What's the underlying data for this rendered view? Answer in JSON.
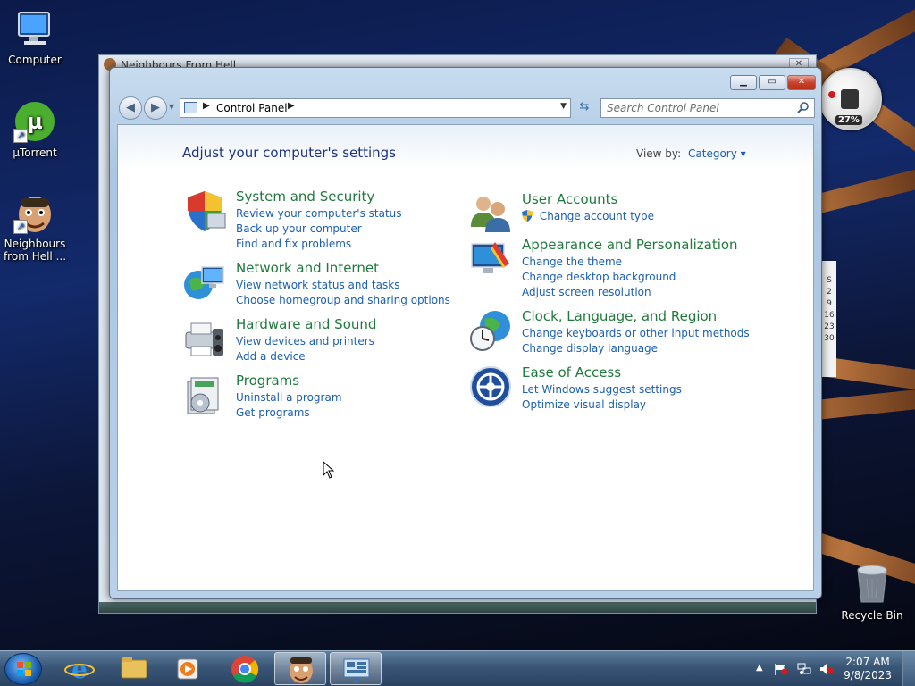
{
  "desktop": {
    "icons": [
      {
        "label": "Computer"
      },
      {
        "label": "µTorrent"
      },
      {
        "label": "Neighbours from Hell ..."
      },
      {
        "label": "Recycle Bin"
      }
    ]
  },
  "background_window": {
    "title": "Neighbours From Hell",
    "close_label": "✕"
  },
  "gadget": {
    "percent": "27%",
    "calendar_days": [
      "S",
      "2",
      "9",
      "16",
      "23",
      "30"
    ]
  },
  "window": {
    "minimize_label": "▁",
    "maximize_label": "▭",
    "close_label": "✕",
    "back_label": "◀",
    "forward_label": "▶",
    "address_path": "Control Panel",
    "search_placeholder": "Search Control Panel"
  },
  "main": {
    "title": "Adjust your computer's settings",
    "view_by_label": "View by:",
    "view_by_value": "Category ▾",
    "categories_left": [
      {
        "title": "System and Security",
        "icon": "system-security-icon",
        "links": [
          "Review your computer's status",
          "Back up your computer",
          "Find and fix problems"
        ]
      },
      {
        "title": "Network and Internet",
        "icon": "network-internet-icon",
        "links": [
          "View network status and tasks",
          "Choose homegroup and sharing options"
        ]
      },
      {
        "title": "Hardware and Sound",
        "icon": "hardware-sound-icon",
        "links": [
          "View devices and printers",
          "Add a device"
        ]
      },
      {
        "title": "Programs",
        "icon": "programs-icon",
        "links": [
          "Uninstall a program",
          "Get programs"
        ]
      }
    ],
    "categories_right": [
      {
        "title": "User Accounts",
        "icon": "user-accounts-icon",
        "links": [
          "Change account type"
        ]
      },
      {
        "title": "Appearance and Personalization",
        "icon": "appearance-icon",
        "links": [
          "Change the theme",
          "Change desktop background",
          "Adjust screen resolution"
        ]
      },
      {
        "title": "Clock, Language, and Region",
        "icon": "clock-region-icon",
        "links": [
          "Change keyboards or other input methods",
          "Change display language"
        ]
      },
      {
        "title": "Ease of Access",
        "icon": "ease-of-access-icon",
        "links": [
          "Let Windows suggest settings",
          "Optimize visual display"
        ]
      }
    ]
  },
  "taskbar": {
    "time": "2:07 AM",
    "date": "9/8/2023"
  },
  "colors": {
    "link": "#1a5fb4",
    "category_title": "#1e7a3c",
    "page_title": "#1e3287"
  }
}
